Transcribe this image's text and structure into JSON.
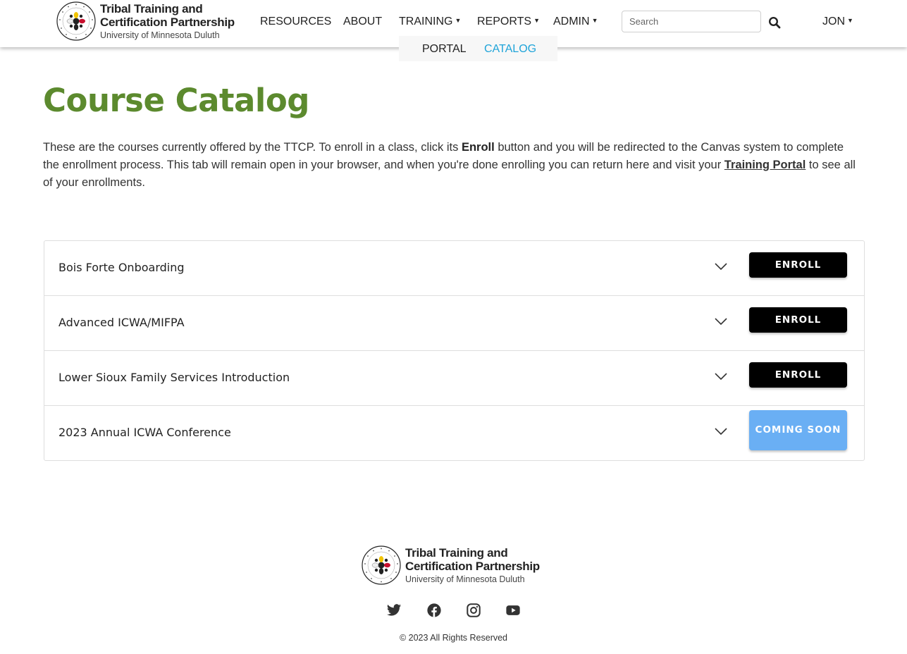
{
  "brand": {
    "line1": "Tribal Training and",
    "line2": "Certification Partnership",
    "line3": "University of Minnesota Duluth",
    "accent_green": "#5c8a2e",
    "link_blue": "#1fa4d9"
  },
  "nav": {
    "items": [
      {
        "label": "Resources",
        "dropdown": false
      },
      {
        "label": "About",
        "dropdown": false
      },
      {
        "label": "Training",
        "dropdown": true
      },
      {
        "label": "Reports",
        "dropdown": true
      },
      {
        "label": "Admin",
        "dropdown": true
      }
    ],
    "submenu": [
      {
        "label": "Portal",
        "active": false
      },
      {
        "label": "Catalog",
        "active": true
      }
    ],
    "user": "Jon"
  },
  "search": {
    "placeholder": "Search",
    "value": ""
  },
  "page": {
    "title": "Course Catalog",
    "intro_part1": "These are the courses currently offered by the TTCP. To enroll in a class, click its ",
    "intro_bold": "Enroll",
    "intro_part2": " button and you will be redirected to the Canvas system to complete the enrollment process. This tab will remain open in your browser, and when you're done enrolling you can return here and visit your ",
    "intro_link": "Training Portal",
    "intro_part3": " to see all of your enrollments."
  },
  "courses": [
    {
      "title": "Bois Forte Onboarding",
      "action": "Enroll",
      "status": "enroll"
    },
    {
      "title": "Advanced ICWA/MIFPA",
      "action": "Enroll",
      "status": "enroll"
    },
    {
      "title": "Lower Sioux Family Services Introduction",
      "action": "Enroll",
      "status": "enroll"
    },
    {
      "title": "2023 Annual ICWA Conference",
      "action": "Coming Soon",
      "status": "coming-soon"
    }
  ],
  "footer": {
    "socials": [
      "twitter-icon",
      "facebook-icon",
      "instagram-icon",
      "youtube-icon"
    ],
    "copyright": "© 2023 All Rights Reserved"
  }
}
